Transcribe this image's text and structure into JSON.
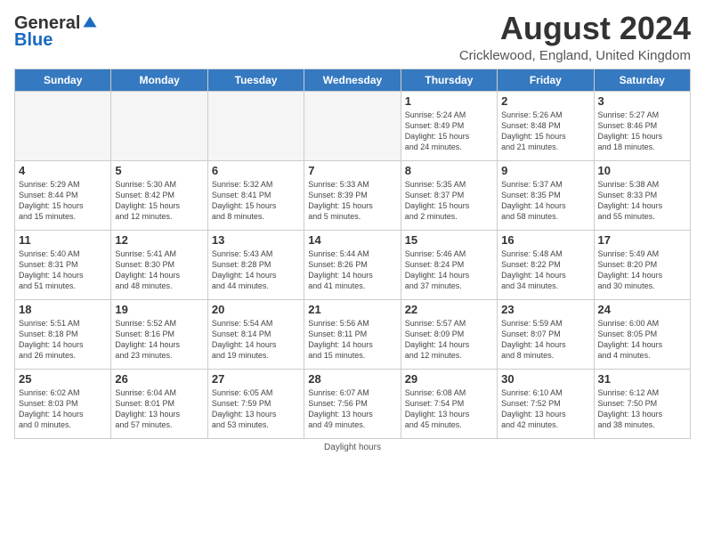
{
  "logo": {
    "general": "General",
    "blue": "Blue"
  },
  "title": "August 2024",
  "location": "Cricklewood, England, United Kingdom",
  "days_of_week": [
    "Sunday",
    "Monday",
    "Tuesday",
    "Wednesday",
    "Thursday",
    "Friday",
    "Saturday"
  ],
  "footer": "Daylight hours",
  "weeks": [
    [
      {
        "day": "",
        "info": ""
      },
      {
        "day": "",
        "info": ""
      },
      {
        "day": "",
        "info": ""
      },
      {
        "day": "",
        "info": ""
      },
      {
        "day": "1",
        "info": "Sunrise: 5:24 AM\nSunset: 8:49 PM\nDaylight: 15 hours\nand 24 minutes."
      },
      {
        "day": "2",
        "info": "Sunrise: 5:26 AM\nSunset: 8:48 PM\nDaylight: 15 hours\nand 21 minutes."
      },
      {
        "day": "3",
        "info": "Sunrise: 5:27 AM\nSunset: 8:46 PM\nDaylight: 15 hours\nand 18 minutes."
      }
    ],
    [
      {
        "day": "4",
        "info": "Sunrise: 5:29 AM\nSunset: 8:44 PM\nDaylight: 15 hours\nand 15 minutes."
      },
      {
        "day": "5",
        "info": "Sunrise: 5:30 AM\nSunset: 8:42 PM\nDaylight: 15 hours\nand 12 minutes."
      },
      {
        "day": "6",
        "info": "Sunrise: 5:32 AM\nSunset: 8:41 PM\nDaylight: 15 hours\nand 8 minutes."
      },
      {
        "day": "7",
        "info": "Sunrise: 5:33 AM\nSunset: 8:39 PM\nDaylight: 15 hours\nand 5 minutes."
      },
      {
        "day": "8",
        "info": "Sunrise: 5:35 AM\nSunset: 8:37 PM\nDaylight: 15 hours\nand 2 minutes."
      },
      {
        "day": "9",
        "info": "Sunrise: 5:37 AM\nSunset: 8:35 PM\nDaylight: 14 hours\nand 58 minutes."
      },
      {
        "day": "10",
        "info": "Sunrise: 5:38 AM\nSunset: 8:33 PM\nDaylight: 14 hours\nand 55 minutes."
      }
    ],
    [
      {
        "day": "11",
        "info": "Sunrise: 5:40 AM\nSunset: 8:31 PM\nDaylight: 14 hours\nand 51 minutes."
      },
      {
        "day": "12",
        "info": "Sunrise: 5:41 AM\nSunset: 8:30 PM\nDaylight: 14 hours\nand 48 minutes."
      },
      {
        "day": "13",
        "info": "Sunrise: 5:43 AM\nSunset: 8:28 PM\nDaylight: 14 hours\nand 44 minutes."
      },
      {
        "day": "14",
        "info": "Sunrise: 5:44 AM\nSunset: 8:26 PM\nDaylight: 14 hours\nand 41 minutes."
      },
      {
        "day": "15",
        "info": "Sunrise: 5:46 AM\nSunset: 8:24 PM\nDaylight: 14 hours\nand 37 minutes."
      },
      {
        "day": "16",
        "info": "Sunrise: 5:48 AM\nSunset: 8:22 PM\nDaylight: 14 hours\nand 34 minutes."
      },
      {
        "day": "17",
        "info": "Sunrise: 5:49 AM\nSunset: 8:20 PM\nDaylight: 14 hours\nand 30 minutes."
      }
    ],
    [
      {
        "day": "18",
        "info": "Sunrise: 5:51 AM\nSunset: 8:18 PM\nDaylight: 14 hours\nand 26 minutes."
      },
      {
        "day": "19",
        "info": "Sunrise: 5:52 AM\nSunset: 8:16 PM\nDaylight: 14 hours\nand 23 minutes."
      },
      {
        "day": "20",
        "info": "Sunrise: 5:54 AM\nSunset: 8:14 PM\nDaylight: 14 hours\nand 19 minutes."
      },
      {
        "day": "21",
        "info": "Sunrise: 5:56 AM\nSunset: 8:11 PM\nDaylight: 14 hours\nand 15 minutes."
      },
      {
        "day": "22",
        "info": "Sunrise: 5:57 AM\nSunset: 8:09 PM\nDaylight: 14 hours\nand 12 minutes."
      },
      {
        "day": "23",
        "info": "Sunrise: 5:59 AM\nSunset: 8:07 PM\nDaylight: 14 hours\nand 8 minutes."
      },
      {
        "day": "24",
        "info": "Sunrise: 6:00 AM\nSunset: 8:05 PM\nDaylight: 14 hours\nand 4 minutes."
      }
    ],
    [
      {
        "day": "25",
        "info": "Sunrise: 6:02 AM\nSunset: 8:03 PM\nDaylight: 14 hours\nand 0 minutes."
      },
      {
        "day": "26",
        "info": "Sunrise: 6:04 AM\nSunset: 8:01 PM\nDaylight: 13 hours\nand 57 minutes."
      },
      {
        "day": "27",
        "info": "Sunrise: 6:05 AM\nSunset: 7:59 PM\nDaylight: 13 hours\nand 53 minutes."
      },
      {
        "day": "28",
        "info": "Sunrise: 6:07 AM\nSunset: 7:56 PM\nDaylight: 13 hours\nand 49 minutes."
      },
      {
        "day": "29",
        "info": "Sunrise: 6:08 AM\nSunset: 7:54 PM\nDaylight: 13 hours\nand 45 minutes."
      },
      {
        "day": "30",
        "info": "Sunrise: 6:10 AM\nSunset: 7:52 PM\nDaylight: 13 hours\nand 42 minutes."
      },
      {
        "day": "31",
        "info": "Sunrise: 6:12 AM\nSunset: 7:50 PM\nDaylight: 13 hours\nand 38 minutes."
      }
    ]
  ]
}
